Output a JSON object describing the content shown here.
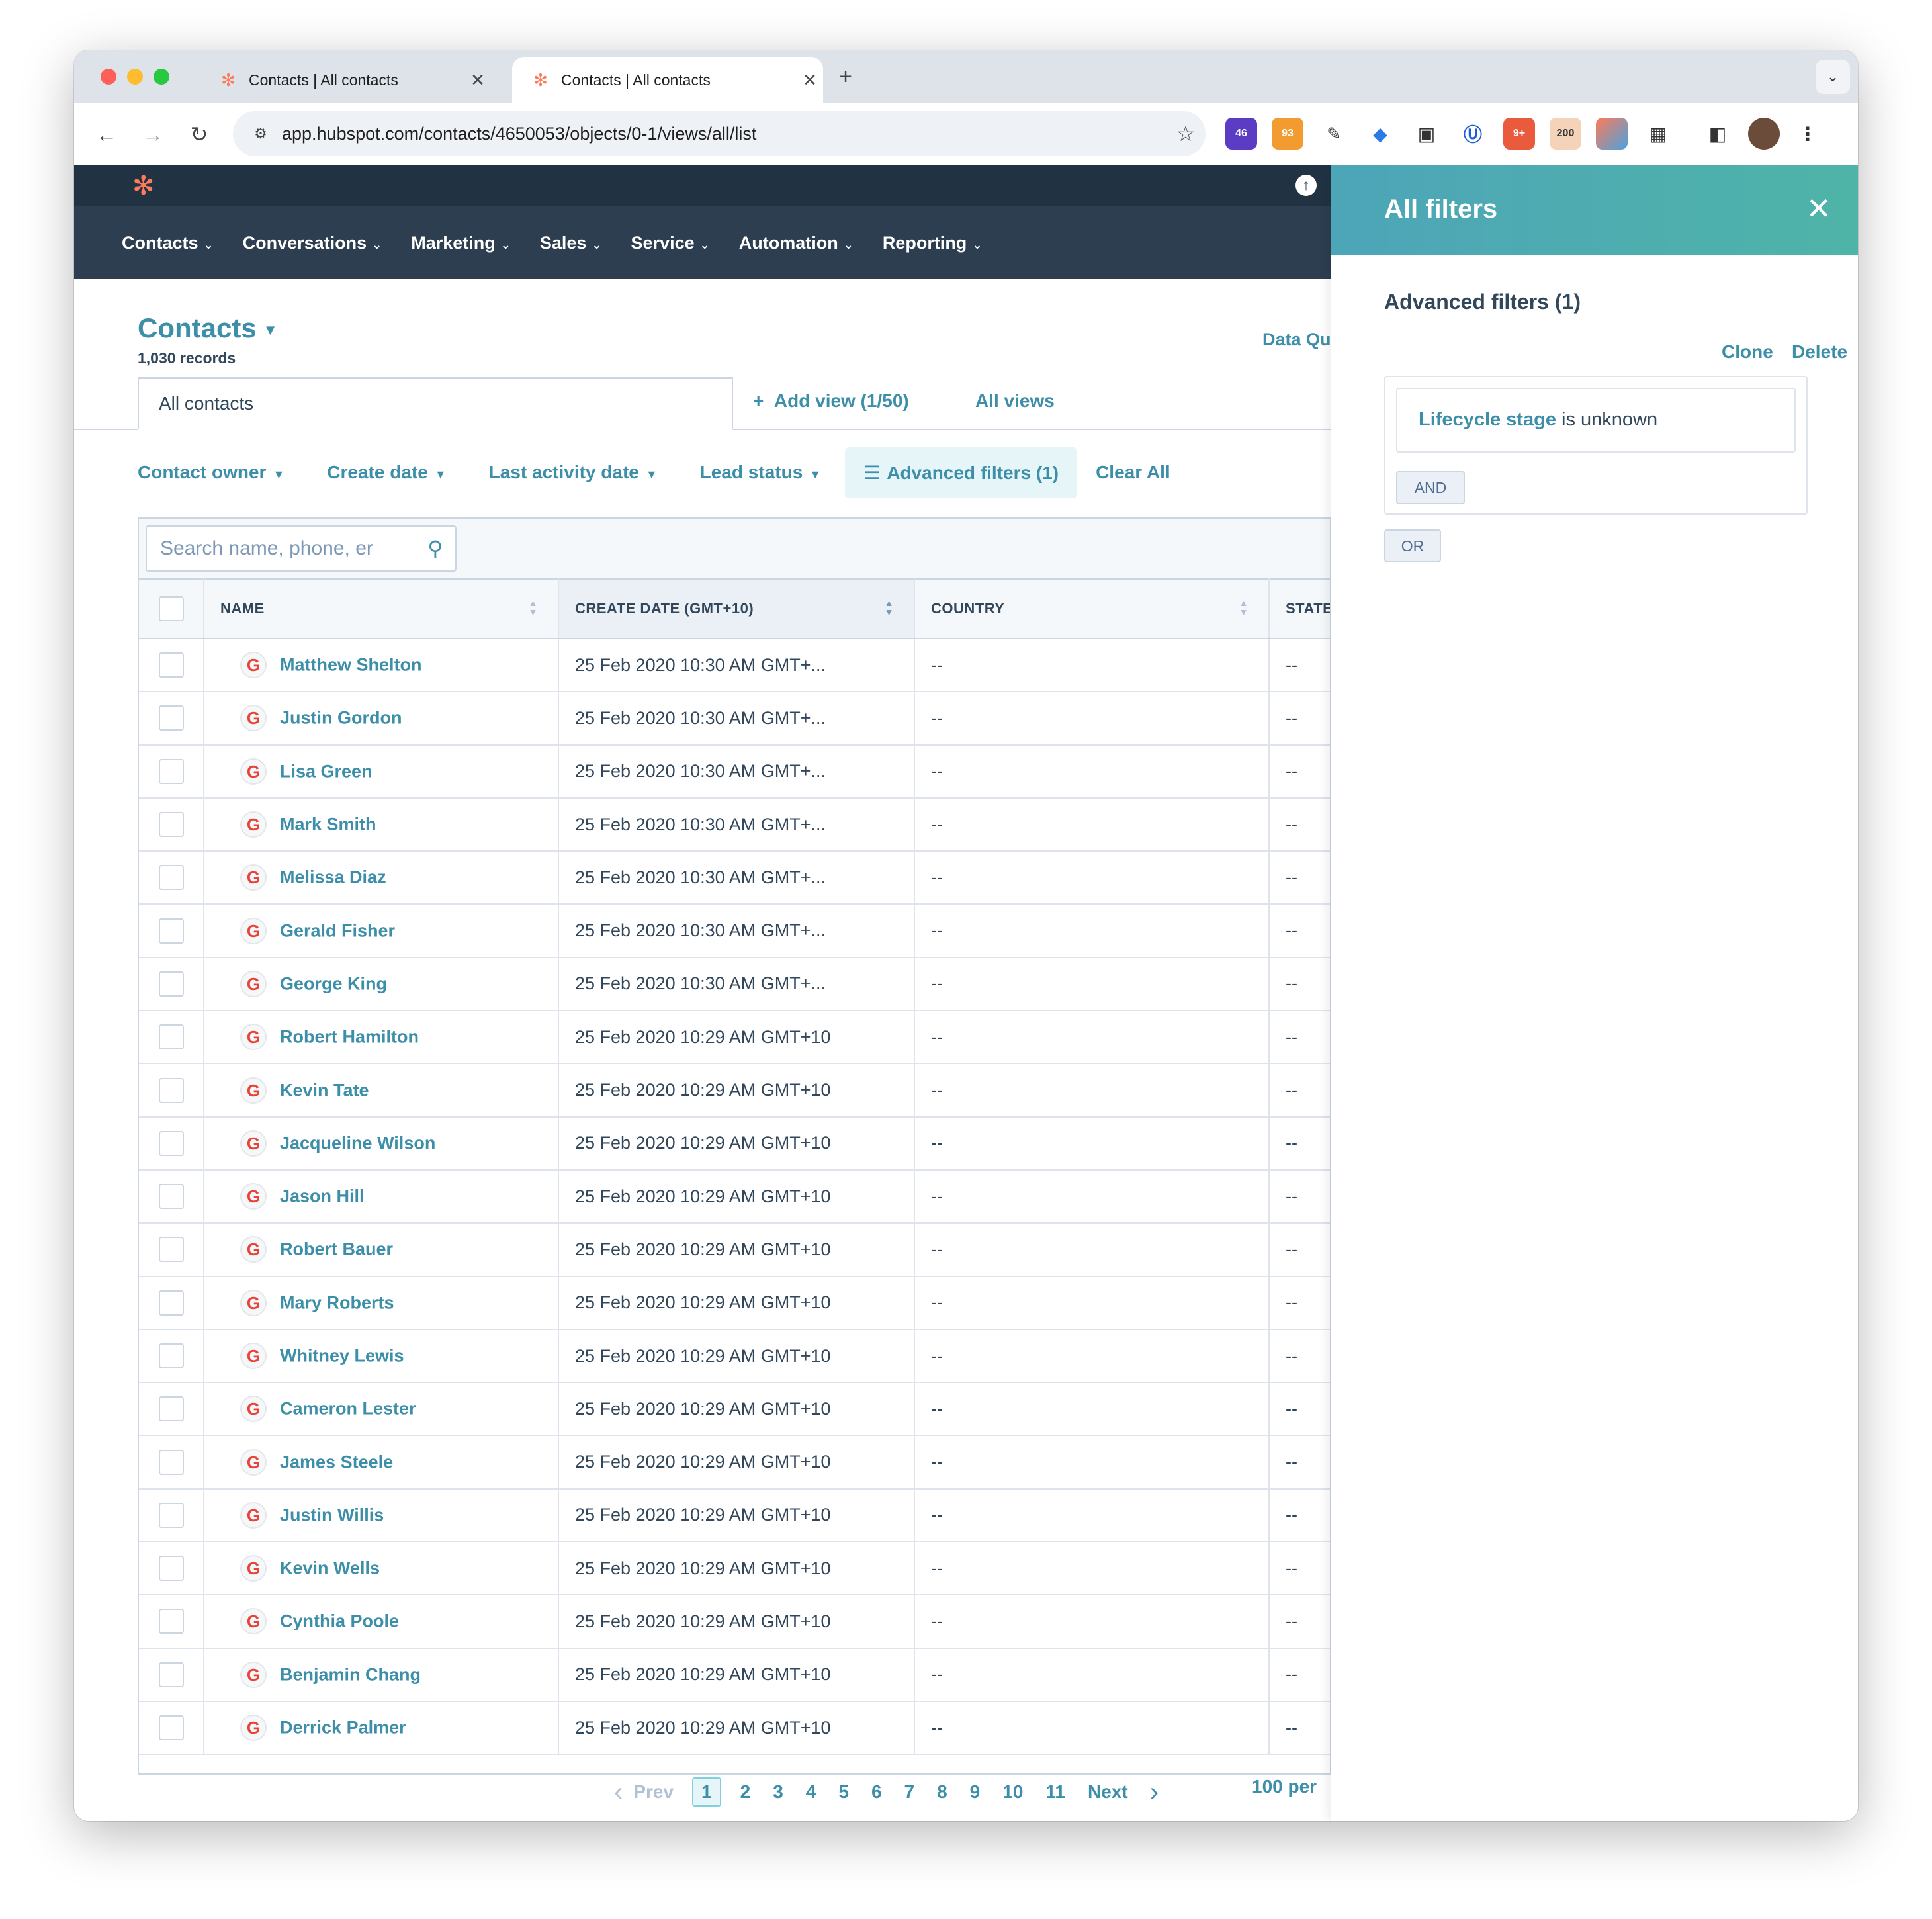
{
  "browser": {
    "tabs": [
      {
        "title": "Contacts | All contacts",
        "active": false
      },
      {
        "title": "Contacts | All contacts",
        "active": true
      }
    ],
    "url": "app.hubspot.com/contacts/4650053/objects/0-1/views/all/list",
    "extension_badges": {
      "ext1": "46",
      "ext2": "93",
      "ext3": "9+",
      "ext4": "200"
    }
  },
  "nav": {
    "items": [
      "Contacts",
      "Conversations",
      "Marketing",
      "Sales",
      "Service",
      "Automation",
      "Reporting"
    ]
  },
  "page": {
    "title": "Contacts",
    "records": "1,030 records",
    "data_quality": "Data Qu",
    "view_tab": "All contacts",
    "add_view": "Add view (1/50)",
    "all_views": "All views"
  },
  "filters": {
    "contact_owner": "Contact owner",
    "create_date": "Create date",
    "last_activity": "Last activity date",
    "lead_status": "Lead status",
    "advanced": "Advanced filters (1)",
    "clear_all": "Clear All"
  },
  "search": {
    "placeholder": "Search name, phone, er"
  },
  "table": {
    "columns": {
      "name": "NAME",
      "create_date": "CREATE DATE (GMT+10)",
      "country": "COUNTRY",
      "state": "STATE"
    },
    "rows": [
      {
        "name": "Matthew Shelton",
        "date": "25 Feb 2020 10:30 AM GMT+...",
        "country": "--",
        "state": "--"
      },
      {
        "name": "Justin Gordon",
        "date": "25 Feb 2020 10:30 AM GMT+...",
        "country": "--",
        "state": "--"
      },
      {
        "name": "Lisa Green",
        "date": "25 Feb 2020 10:30 AM GMT+...",
        "country": "--",
        "state": "--"
      },
      {
        "name": "Mark Smith",
        "date": "25 Feb 2020 10:30 AM GMT+...",
        "country": "--",
        "state": "--"
      },
      {
        "name": "Melissa Diaz",
        "date": "25 Feb 2020 10:30 AM GMT+...",
        "country": "--",
        "state": "--"
      },
      {
        "name": "Gerald Fisher",
        "date": "25 Feb 2020 10:30 AM GMT+...",
        "country": "--",
        "state": "--"
      },
      {
        "name": "George King",
        "date": "25 Feb 2020 10:30 AM GMT+...",
        "country": "--",
        "state": "--"
      },
      {
        "name": "Robert Hamilton",
        "date": "25 Feb 2020 10:29 AM GMT+10",
        "country": "--",
        "state": "--"
      },
      {
        "name": "Kevin Tate",
        "date": "25 Feb 2020 10:29 AM GMT+10",
        "country": "--",
        "state": "--"
      },
      {
        "name": "Jacqueline Wilson",
        "date": "25 Feb 2020 10:29 AM GMT+10",
        "country": "--",
        "state": "--"
      },
      {
        "name": "Jason Hill",
        "date": "25 Feb 2020 10:29 AM GMT+10",
        "country": "--",
        "state": "--"
      },
      {
        "name": "Robert Bauer",
        "date": "25 Feb 2020 10:29 AM GMT+10",
        "country": "--",
        "state": "--"
      },
      {
        "name": "Mary Roberts",
        "date": "25 Feb 2020 10:29 AM GMT+10",
        "country": "--",
        "state": "--"
      },
      {
        "name": "Whitney Lewis",
        "date": "25 Feb 2020 10:29 AM GMT+10",
        "country": "--",
        "state": "--"
      },
      {
        "name": "Cameron Lester",
        "date": "25 Feb 2020 10:29 AM GMT+10",
        "country": "--",
        "state": "--"
      },
      {
        "name": "James Steele",
        "date": "25 Feb 2020 10:29 AM GMT+10",
        "country": "--",
        "state": "--"
      },
      {
        "name": "Justin Willis",
        "date": "25 Feb 2020 10:29 AM GMT+10",
        "country": "--",
        "state": "--"
      },
      {
        "name": "Kevin Wells",
        "date": "25 Feb 2020 10:29 AM GMT+10",
        "country": "--",
        "state": "--"
      },
      {
        "name": "Cynthia Poole",
        "date": "25 Feb 2020 10:29 AM GMT+10",
        "country": "--",
        "state": "--"
      },
      {
        "name": "Benjamin Chang",
        "date": "25 Feb 2020 10:29 AM GMT+10",
        "country": "--",
        "state": "--"
      },
      {
        "name": "Derrick Palmer",
        "date": "25 Feb 2020 10:29 AM GMT+10",
        "country": "--",
        "state": "--"
      }
    ]
  },
  "pagination": {
    "prev": "Prev",
    "pages": [
      "1",
      "2",
      "3",
      "4",
      "5",
      "6",
      "7",
      "8",
      "9",
      "10",
      "11"
    ],
    "current": "1",
    "next": "Next",
    "per_page": "100 per"
  },
  "panel": {
    "title": "All filters",
    "advanced_heading": "Advanced filters (1)",
    "clone": "Clone",
    "delete": "Delete",
    "condition_property": "Lifecycle stage",
    "condition_operator": "is unknown",
    "and_label": "AND",
    "or_label": "OR"
  },
  "icons": {
    "avatar": "google-g-icon",
    "close": "close-icon",
    "search": "search-icon"
  },
  "colors": {
    "link": "#3d8ea8",
    "nav_bg": "#2d3e50",
    "topbar_bg": "#213343",
    "panel_header": "#4da5b8",
    "brand_orange": "#ff7a59"
  }
}
